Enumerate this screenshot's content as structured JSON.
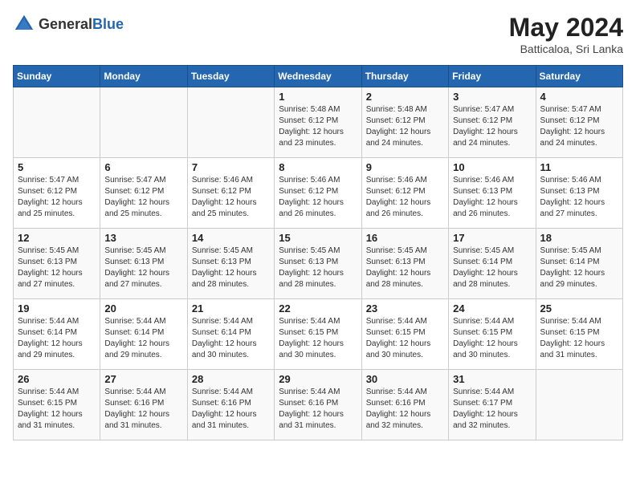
{
  "header": {
    "logo_general": "General",
    "logo_blue": "Blue",
    "month_year": "May 2024",
    "location": "Batticaloa, Sri Lanka"
  },
  "weekdays": [
    "Sunday",
    "Monday",
    "Tuesday",
    "Wednesday",
    "Thursday",
    "Friday",
    "Saturday"
  ],
  "rows": [
    [
      {
        "day": "",
        "info": ""
      },
      {
        "day": "",
        "info": ""
      },
      {
        "day": "",
        "info": ""
      },
      {
        "day": "1",
        "info": "Sunrise: 5:48 AM\nSunset: 6:12 PM\nDaylight: 12 hours\nand 23 minutes."
      },
      {
        "day": "2",
        "info": "Sunrise: 5:48 AM\nSunset: 6:12 PM\nDaylight: 12 hours\nand 24 minutes."
      },
      {
        "day": "3",
        "info": "Sunrise: 5:47 AM\nSunset: 6:12 PM\nDaylight: 12 hours\nand 24 minutes."
      },
      {
        "day": "4",
        "info": "Sunrise: 5:47 AM\nSunset: 6:12 PM\nDaylight: 12 hours\nand 24 minutes."
      }
    ],
    [
      {
        "day": "5",
        "info": "Sunrise: 5:47 AM\nSunset: 6:12 PM\nDaylight: 12 hours\nand 25 minutes."
      },
      {
        "day": "6",
        "info": "Sunrise: 5:47 AM\nSunset: 6:12 PM\nDaylight: 12 hours\nand 25 minutes."
      },
      {
        "day": "7",
        "info": "Sunrise: 5:46 AM\nSunset: 6:12 PM\nDaylight: 12 hours\nand 25 minutes."
      },
      {
        "day": "8",
        "info": "Sunrise: 5:46 AM\nSunset: 6:12 PM\nDaylight: 12 hours\nand 26 minutes."
      },
      {
        "day": "9",
        "info": "Sunrise: 5:46 AM\nSunset: 6:12 PM\nDaylight: 12 hours\nand 26 minutes."
      },
      {
        "day": "10",
        "info": "Sunrise: 5:46 AM\nSunset: 6:13 PM\nDaylight: 12 hours\nand 26 minutes."
      },
      {
        "day": "11",
        "info": "Sunrise: 5:46 AM\nSunset: 6:13 PM\nDaylight: 12 hours\nand 27 minutes."
      }
    ],
    [
      {
        "day": "12",
        "info": "Sunrise: 5:45 AM\nSunset: 6:13 PM\nDaylight: 12 hours\nand 27 minutes."
      },
      {
        "day": "13",
        "info": "Sunrise: 5:45 AM\nSunset: 6:13 PM\nDaylight: 12 hours\nand 27 minutes."
      },
      {
        "day": "14",
        "info": "Sunrise: 5:45 AM\nSunset: 6:13 PM\nDaylight: 12 hours\nand 28 minutes."
      },
      {
        "day": "15",
        "info": "Sunrise: 5:45 AM\nSunset: 6:13 PM\nDaylight: 12 hours\nand 28 minutes."
      },
      {
        "day": "16",
        "info": "Sunrise: 5:45 AM\nSunset: 6:13 PM\nDaylight: 12 hours\nand 28 minutes."
      },
      {
        "day": "17",
        "info": "Sunrise: 5:45 AM\nSunset: 6:14 PM\nDaylight: 12 hours\nand 28 minutes."
      },
      {
        "day": "18",
        "info": "Sunrise: 5:45 AM\nSunset: 6:14 PM\nDaylight: 12 hours\nand 29 minutes."
      }
    ],
    [
      {
        "day": "19",
        "info": "Sunrise: 5:44 AM\nSunset: 6:14 PM\nDaylight: 12 hours\nand 29 minutes."
      },
      {
        "day": "20",
        "info": "Sunrise: 5:44 AM\nSunset: 6:14 PM\nDaylight: 12 hours\nand 29 minutes."
      },
      {
        "day": "21",
        "info": "Sunrise: 5:44 AM\nSunset: 6:14 PM\nDaylight: 12 hours\nand 30 minutes."
      },
      {
        "day": "22",
        "info": "Sunrise: 5:44 AM\nSunset: 6:15 PM\nDaylight: 12 hours\nand 30 minutes."
      },
      {
        "day": "23",
        "info": "Sunrise: 5:44 AM\nSunset: 6:15 PM\nDaylight: 12 hours\nand 30 minutes."
      },
      {
        "day": "24",
        "info": "Sunrise: 5:44 AM\nSunset: 6:15 PM\nDaylight: 12 hours\nand 30 minutes."
      },
      {
        "day": "25",
        "info": "Sunrise: 5:44 AM\nSunset: 6:15 PM\nDaylight: 12 hours\nand 31 minutes."
      }
    ],
    [
      {
        "day": "26",
        "info": "Sunrise: 5:44 AM\nSunset: 6:15 PM\nDaylight: 12 hours\nand 31 minutes."
      },
      {
        "day": "27",
        "info": "Sunrise: 5:44 AM\nSunset: 6:16 PM\nDaylight: 12 hours\nand 31 minutes."
      },
      {
        "day": "28",
        "info": "Sunrise: 5:44 AM\nSunset: 6:16 PM\nDaylight: 12 hours\nand 31 minutes."
      },
      {
        "day": "29",
        "info": "Sunrise: 5:44 AM\nSunset: 6:16 PM\nDaylight: 12 hours\nand 31 minutes."
      },
      {
        "day": "30",
        "info": "Sunrise: 5:44 AM\nSunset: 6:16 PM\nDaylight: 12 hours\nand 32 minutes."
      },
      {
        "day": "31",
        "info": "Sunrise: 5:44 AM\nSunset: 6:17 PM\nDaylight: 12 hours\nand 32 minutes."
      },
      {
        "day": "",
        "info": ""
      }
    ]
  ]
}
